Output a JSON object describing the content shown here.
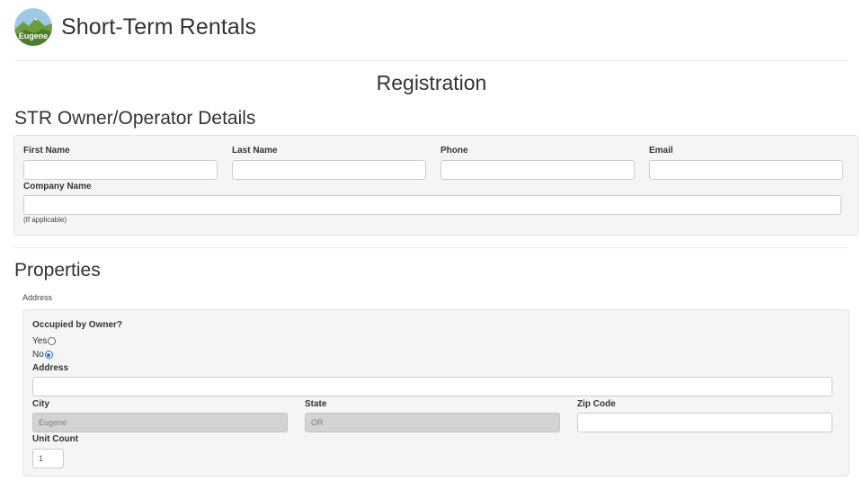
{
  "header": {
    "logo_text": "Eugene",
    "title": "Short-Term Rentals"
  },
  "page": {
    "title": "Registration"
  },
  "owner_section": {
    "title": "STR Owner/Operator Details",
    "first_name_label": "First Name",
    "first_name_value": "",
    "last_name_label": "Last Name",
    "last_name_value": "",
    "phone_label": "Phone",
    "phone_value": "",
    "email_label": "Email",
    "email_value": "",
    "company_label": "Company Name",
    "company_value": "",
    "company_hint": "(If applicable)"
  },
  "properties_section": {
    "title": "Properties",
    "address_heading": "Address",
    "occupied_label": "Occupied by Owner?",
    "yes_label": "Yes",
    "no_label": "No",
    "selected": "No",
    "address_label": "Address",
    "address_value": "",
    "city_label": "City",
    "city_value": "Eugene",
    "state_label": "State",
    "state_value": "OR",
    "zip_label": "Zip Code",
    "zip_value": "",
    "unit_count_label": "Unit Count",
    "unit_count_value": "1"
  },
  "colors": {
    "well_bg": "#f5f5f5",
    "radio_accent": "#1a73e8",
    "disabled_input": "#d3d3d3"
  }
}
